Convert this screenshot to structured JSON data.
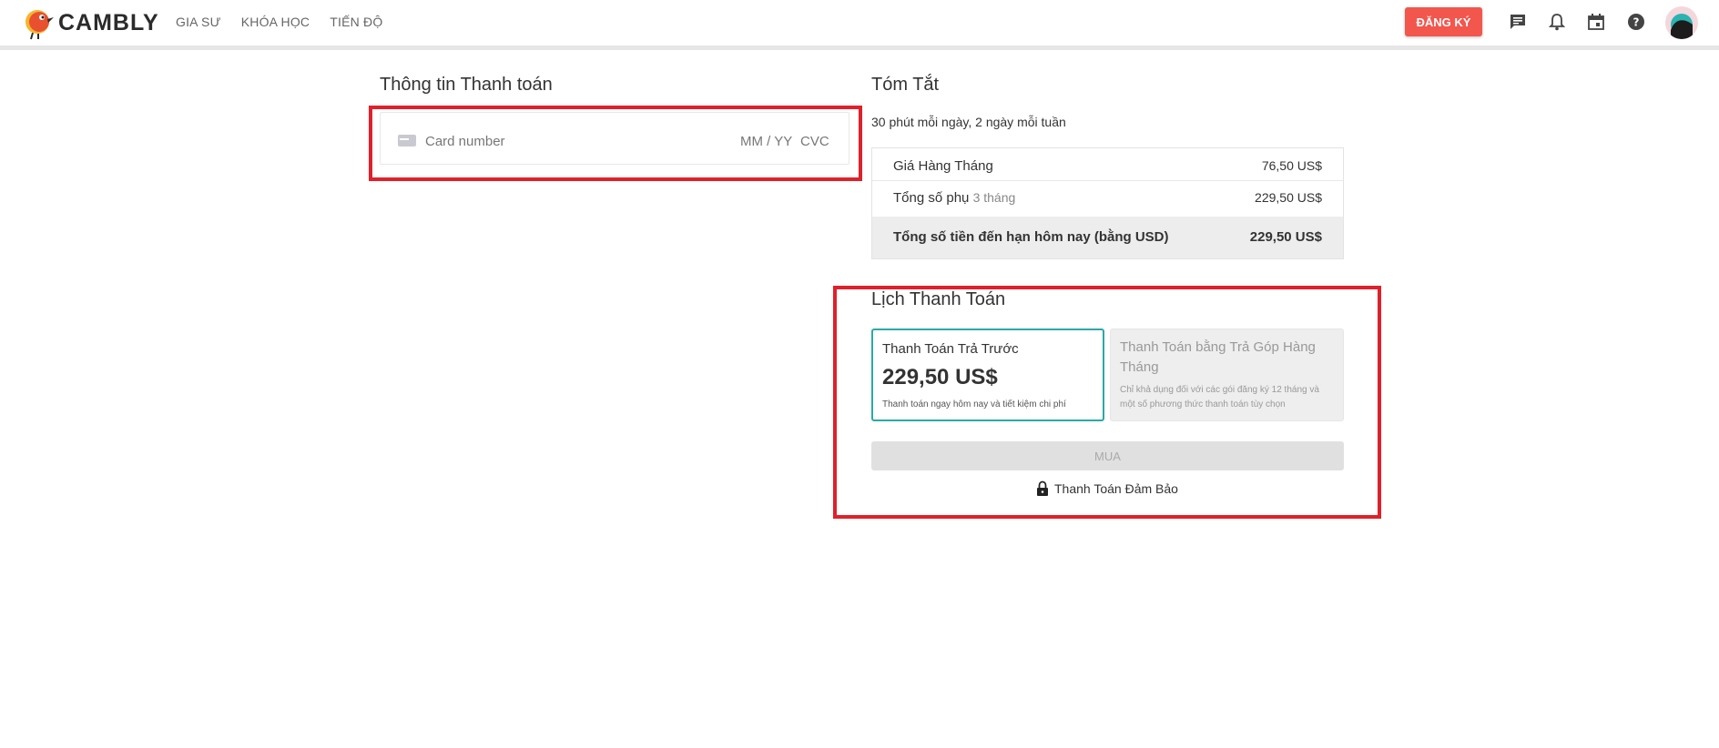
{
  "header": {
    "brand": "CAMBLY",
    "nav": [
      "GIA SƯ",
      "KHÓA HỌC",
      "TIẾN ĐỘ"
    ],
    "signup_label": "ĐĂNG KÝ",
    "icons": [
      "chat-icon",
      "bell-icon",
      "calendar-icon",
      "help-icon"
    ],
    "accent": "#f2564d"
  },
  "payment_info": {
    "title": "Thông tin Thanh toán",
    "card_placeholder": "Card number",
    "expiry_placeholder": "MM / YY",
    "cvc_placeholder": "CVC"
  },
  "summary": {
    "title": "Tóm Tắt",
    "plan_text": "30 phút mỗi ngày, 2 ngày mỗi tuần",
    "monthly_label": "Giá Hàng Tháng",
    "monthly_value": "76,50 US$",
    "subtotal_label": "Tổng số phụ",
    "subtotal_period": "3 tháng",
    "subtotal_value": "229,50 US$",
    "total_label": "Tổng số tiền đến hạn hôm nay (bằng USD)",
    "total_value": "229,50 US$"
  },
  "schedule": {
    "title": "Lịch Thanh Toán",
    "prepay": {
      "title": "Thanh Toán Trả Trước",
      "price": "229,50 US$",
      "note": "Thanh toán ngay hôm nay và tiết kiệm chi phí"
    },
    "installment": {
      "title": "Thanh Toán bằng Trả Góp Hàng Tháng",
      "desc": "Chỉ khả dụng đối với các gói đăng ký 12 tháng và một số phương thức thanh toán tùy chọn"
    },
    "buy_label": "MUA",
    "secure_label": "Thanh Toán Đảm Bảo",
    "selected_color": "#2aa9a5"
  }
}
